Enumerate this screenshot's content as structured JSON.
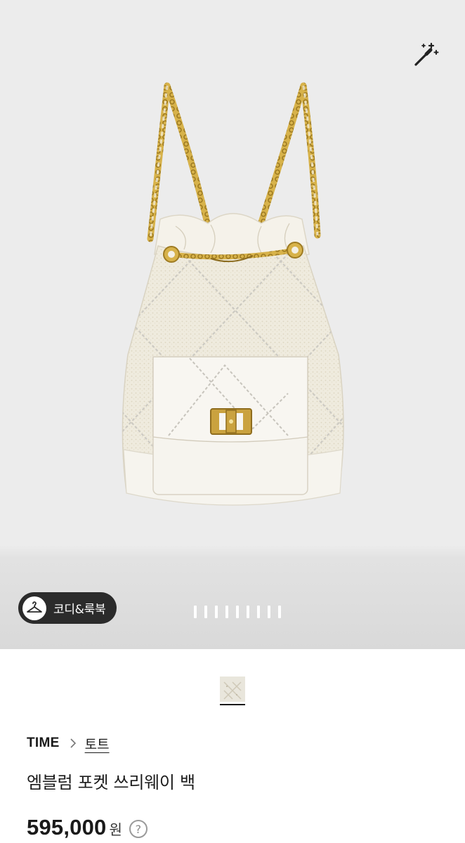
{
  "gallery": {
    "lookbook_label": "코디&룩북",
    "page_count": 9,
    "icons": {
      "magic": "magic-wand-icon",
      "lookbook": "hanger-icon"
    }
  },
  "product": {
    "brand": "TIME",
    "category": "토트",
    "name": "엠블럼 포켓 쓰리웨이 백",
    "price": "595,000",
    "currency": "원",
    "price_help": "?"
  },
  "colors": {
    "background": "#ececec",
    "pill": "#2b2b2b",
    "bag": "#f3f0e6",
    "gold": "#c9a23c"
  }
}
